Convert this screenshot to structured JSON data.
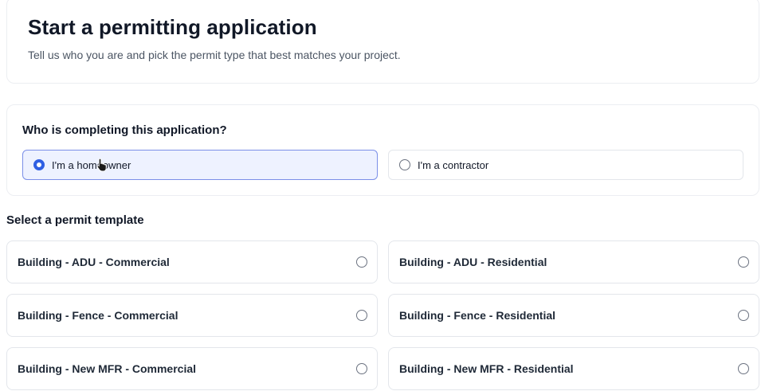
{
  "header": {
    "title": "Start a permitting application",
    "subtitle": "Tell us who you are and pick the permit type that best matches your project."
  },
  "role": {
    "question": "Who is completing this application?",
    "options": [
      {
        "label": "I'm a homeowner",
        "selected": true
      },
      {
        "label": "I'm a contractor",
        "selected": false
      }
    ]
  },
  "templates": {
    "title": "Select a permit template",
    "items": [
      {
        "label": "Building - ADU - Commercial"
      },
      {
        "label": "Building - ADU - Residential"
      },
      {
        "label": "Building - Fence - Commercial"
      },
      {
        "label": "Building - Fence - Residential"
      },
      {
        "label": "Building - New MFR - Commercial"
      },
      {
        "label": "Building - New MFR - Residential"
      }
    ]
  },
  "colors": {
    "accent": "#2f5fe3",
    "selected_bg": "#eef2ff",
    "selected_border": "#7b8fe8"
  },
  "icons": {
    "cursor": "hand-pointer-icon"
  }
}
